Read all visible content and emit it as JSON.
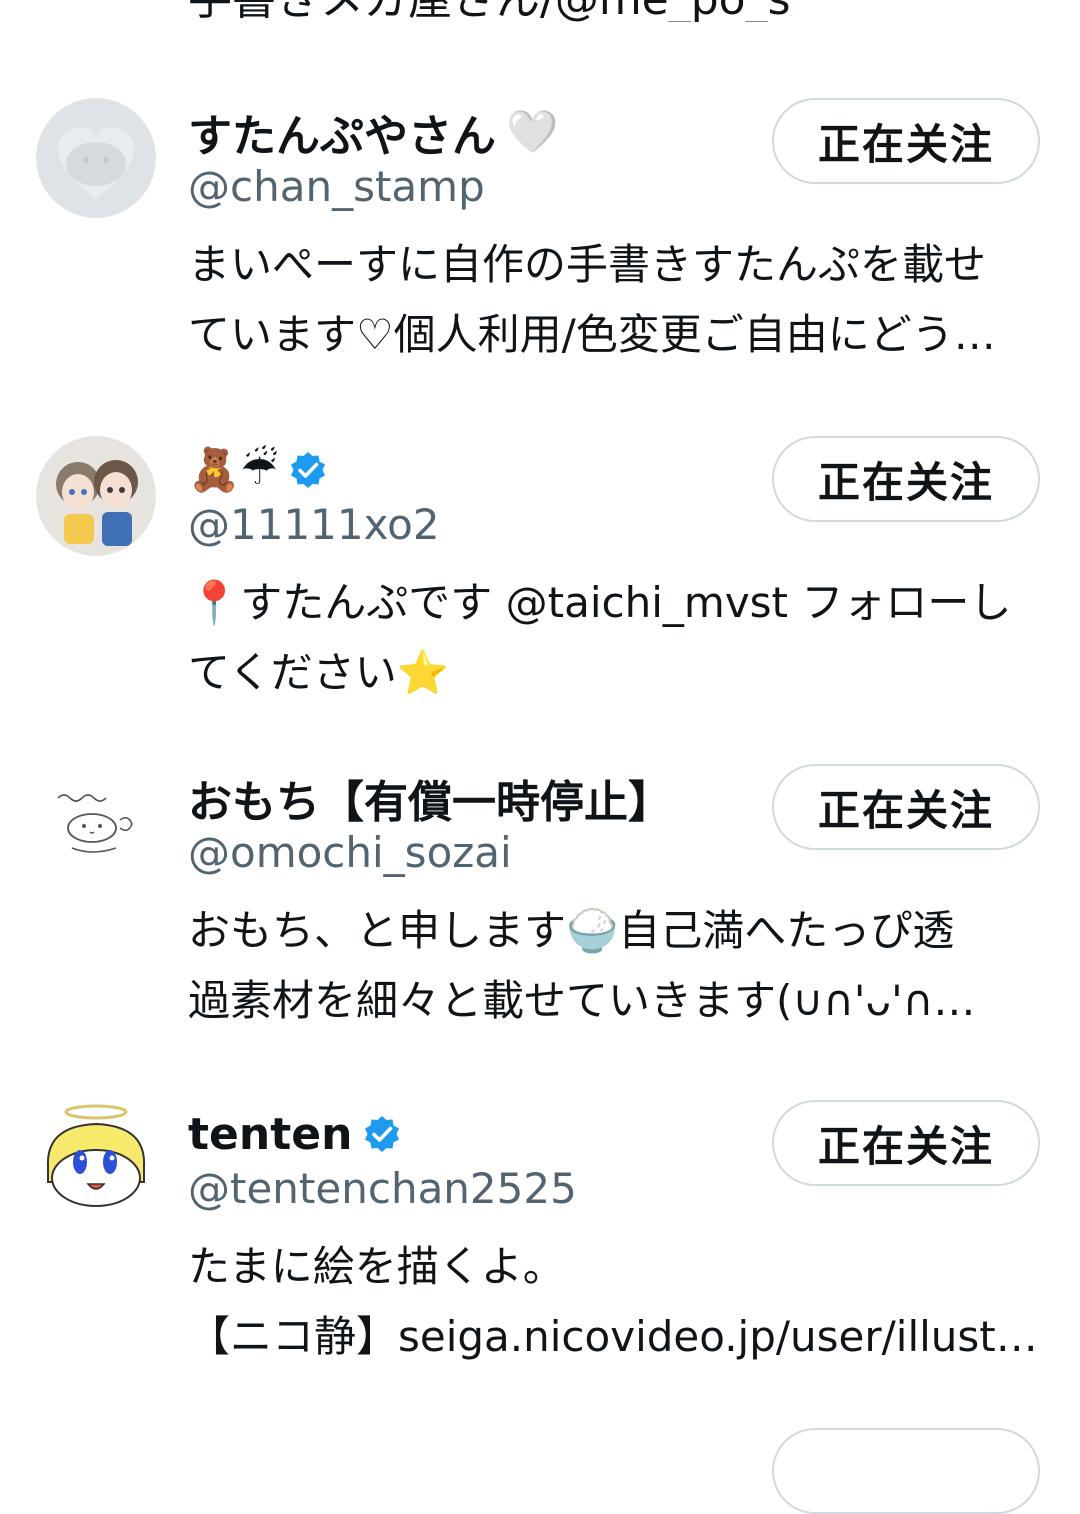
{
  "top_partial_text": "手書きメガ屋さん/@me_po_s ",
  "follow_label": "正在关注",
  "users": [
    {
      "display_name": "すたんぷやさん",
      "name_emoji": "🤍",
      "handle": "@chan_stamp",
      "bio_lines": [
        "まいぺーすに自作の手書きすたんぷを載せ",
        "ています♡個人利用/色変更ご自由にどう…"
      ],
      "verified": false
    },
    {
      "display_name": "🧸☔",
      "name_emoji": "",
      "handle": "@11111xo2",
      "bio_lines": [
        "📍すたんぷです @taichi_mvst フォローし",
        "てください⭐"
      ],
      "verified": true
    },
    {
      "display_name": "おもち【有償一時停止】",
      "name_emoji": "",
      "handle": "@omochi_sozai",
      "bio_lines": [
        "おもち、と申します🍚自己満へたっぴ透",
        "過素材を細々と載せていきます(∪∩'ᴗ'∩…"
      ],
      "verified": false
    },
    {
      "display_name": "tenten",
      "name_emoji": "",
      "handle": "@tentenchan2525",
      "bio_lines": [
        "たまに絵を描くよ。",
        "【ニコ静】seiga.nicovideo.jp/user/illust…"
      ],
      "verified": true
    }
  ],
  "colors": {
    "handle": "#536471",
    "text": "#0f1419",
    "button_border": "#cfd9de",
    "verified_badge": "#1d9bf0"
  }
}
